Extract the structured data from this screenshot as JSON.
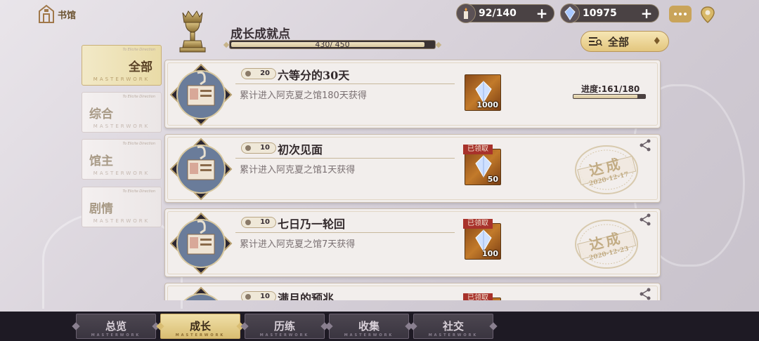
{
  "header": {
    "home_label": "书馆",
    "section_title": "成长成就点",
    "growth_points": "430/ 450",
    "growth_fraction": 0.956,
    "stamina": "92/140",
    "gems": "10975",
    "filter_label": "全部"
  },
  "sidebar": {
    "items": [
      {
        "label": "全部",
        "active": true
      },
      {
        "label": "综合",
        "active": false
      },
      {
        "label": "馆主",
        "active": false
      },
      {
        "label": "剧情",
        "active": false
      }
    ],
    "watermark": "MASTERWORK",
    "small_text": "To Elicite Direction"
  },
  "achievements": [
    {
      "points": "20",
      "title": "六等分的30天",
      "desc": "累计进入阿克夏之馆180天获得",
      "reward_amount": "1000",
      "claimed": false,
      "progress_label": "进度:161/180",
      "progress_fraction": 0.894
    },
    {
      "points": "10",
      "title": "初次见面",
      "desc": "累计进入阿克夏之馆1天获得",
      "reward_amount": "50",
      "claimed": true,
      "claimed_label": "已领取",
      "stamp_text": "达成",
      "stamp_date": "2020-12-17"
    },
    {
      "points": "10",
      "title": "七日乃一轮回",
      "desc": "累计进入阿克夏之馆7天获得",
      "reward_amount": "100",
      "claimed": true,
      "claimed_label": "已领取",
      "stamp_text": "达成",
      "stamp_date": "2020-12-23"
    },
    {
      "points": "10",
      "title": "满月的预兆",
      "desc": "",
      "reward_amount": "",
      "claimed": true,
      "claimed_label": "已领取"
    }
  ],
  "bottom_nav": {
    "items": [
      {
        "label": "总览",
        "active": false
      },
      {
        "label": "成长",
        "active": true
      },
      {
        "label": "历练",
        "active": false
      },
      {
        "label": "收集",
        "active": false
      },
      {
        "label": "社交",
        "active": false
      }
    ],
    "watermark": "MASTERWORK"
  }
}
